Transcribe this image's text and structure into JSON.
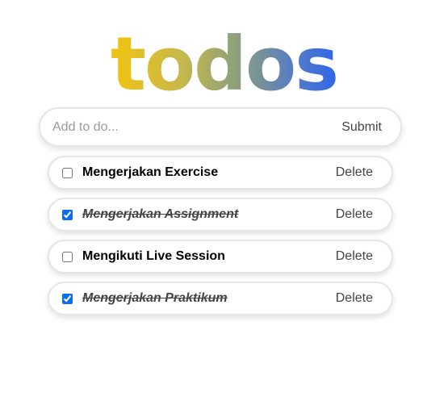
{
  "app": {
    "title": "todos",
    "gradient_colors": [
      "#f1c40f",
      "#2f66ea"
    ]
  },
  "form": {
    "placeholder": "Add to do...",
    "value": "",
    "submit_label": "Submit"
  },
  "todos": [
    {
      "label": "Mengerjakan Exercise",
      "done": false,
      "delete_label": "Delete"
    },
    {
      "label": "Mengerjakan Assignment",
      "done": true,
      "delete_label": "Delete"
    },
    {
      "label": "Mengikuti Live Session",
      "done": false,
      "delete_label": "Delete"
    },
    {
      "label": "Mengerjakan Praktikum",
      "done": true,
      "delete_label": "Delete"
    }
  ],
  "colors": {
    "checkbox_accent": "#0a6cf5",
    "border": "#e6e6e6"
  }
}
